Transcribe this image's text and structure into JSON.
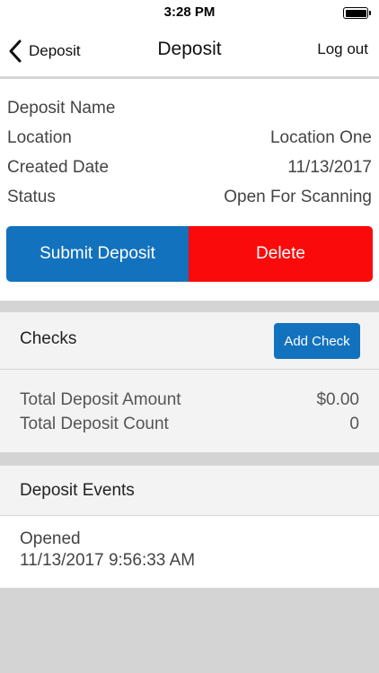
{
  "status_bar": {
    "time": "3:28 PM",
    "battery_icon": "battery-full-icon"
  },
  "nav": {
    "back_label": "Deposit",
    "title": "Deposit",
    "logout_label": "Log out"
  },
  "details": [
    {
      "label": "Deposit Name",
      "value": ""
    },
    {
      "label": "Location",
      "value": "Location One"
    },
    {
      "label": "Created Date",
      "value": "11/13/2017"
    },
    {
      "label": "Status",
      "value": "Open For Scanning"
    }
  ],
  "actions": {
    "submit_label": "Submit Deposit",
    "delete_label": "Delete"
  },
  "checks": {
    "title": "Checks",
    "add_label": "Add Check",
    "totals": [
      {
        "label": "Total Deposit Amount",
        "value": "$0.00"
      },
      {
        "label": "Total Deposit Count",
        "value": "0"
      }
    ]
  },
  "events": {
    "title": "Deposit Events",
    "items": [
      {
        "name": "Opened",
        "timestamp": "11/13/2017 9:56:33 AM"
      }
    ]
  },
  "colors": {
    "primary": "#1372bd",
    "danger": "#fa0a0a",
    "panel_bg": "#f3f3f3",
    "page_bg": "#d4d4d4"
  }
}
